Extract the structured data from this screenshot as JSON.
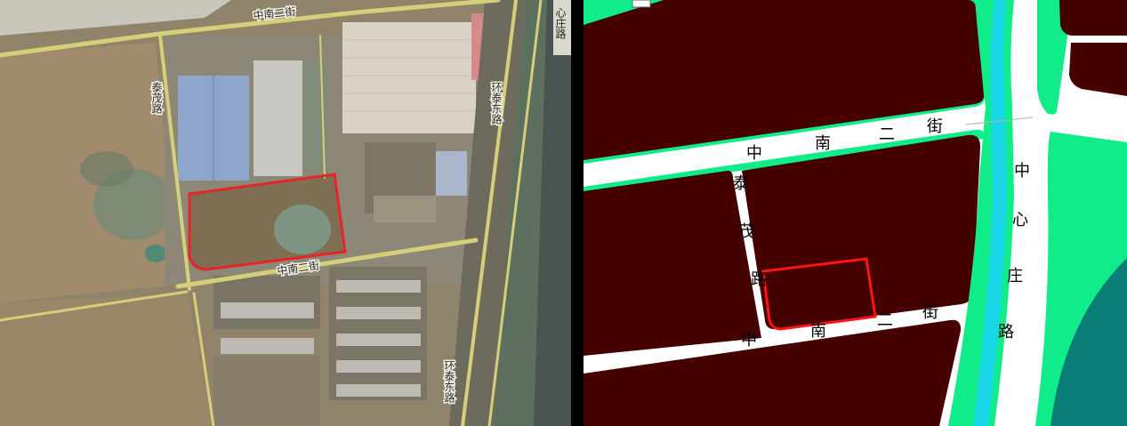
{
  "satellite": {
    "roads": {
      "zhongnan_2_top": "中南二街",
      "zhongnan_2_bottom": "中南二街",
      "taimao": "泰茂路",
      "huantai_east_top": "环泰东路",
      "huantai_east_bottom": "环泰东路",
      "zhongxinzhuang": "心庄路"
    }
  },
  "plan": {
    "roads": {
      "zhongnan_2_upper": [
        "中",
        "南",
        "二",
        "街"
      ],
      "zhongnan_2_lower": [
        "中",
        "南",
        "二",
        "街"
      ],
      "taimao": [
        "泰",
        "茂",
        "路"
      ],
      "zhongxinzhuang": [
        "中",
        "心",
        "庄",
        "路"
      ]
    }
  },
  "colors": {
    "parcel_outline": "#e8242b",
    "plan_land": "#450000",
    "plan_green": "#10ec8a",
    "plan_water": "#18d6e6",
    "plan_teal": "#0b7d77",
    "plan_road": "#ffffff"
  }
}
